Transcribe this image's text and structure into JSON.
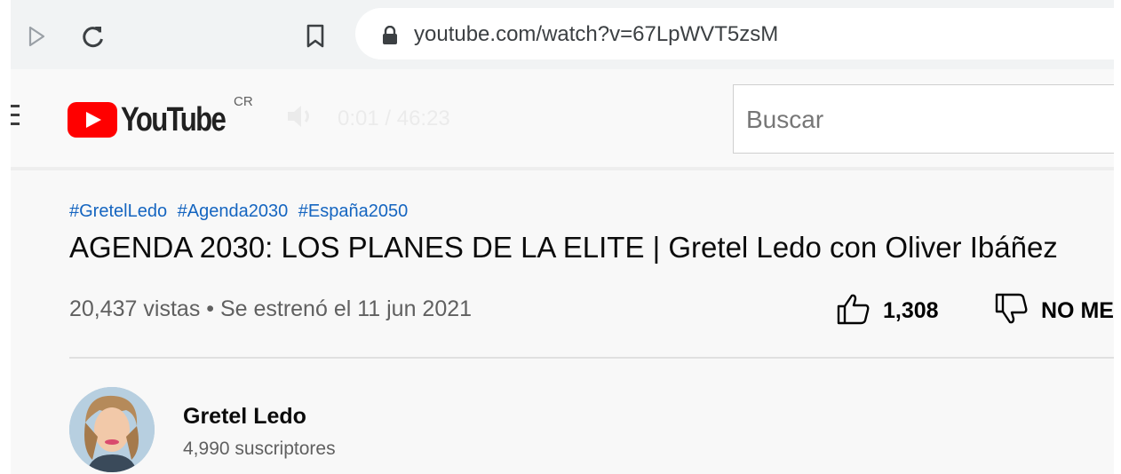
{
  "browser": {
    "url": "youtube.com/watch?v=67LpWVT5zsM"
  },
  "header": {
    "logo_text": "YouTube",
    "country_code": "CR",
    "player_time": "0:01 / 46:23",
    "search": {
      "placeholder": "Buscar"
    }
  },
  "video": {
    "hashtags": [
      "#GretelLedo",
      "#Agenda2030",
      "#España2050"
    ],
    "title": "AGENDA 2030: LOS PLANES DE LA ELITE | Gretel Ledo con Oliver Ibáñez",
    "meta": "20,437 vistas • Se estrenó el 11 jun 2021",
    "likes": "1,308",
    "dislike_label": "NO ME GUSTA"
  },
  "channel": {
    "name": "Gretel Ledo",
    "subscribers": "4,990 suscriptores"
  },
  "colors": {
    "brand_red": "#ff0000",
    "hashtag_blue": "#1565c0",
    "secondary_text": "#606060"
  },
  "icons": [
    "forward-icon",
    "reload-icon",
    "bookmark-icon",
    "lock-icon",
    "menu-icon",
    "volume-icon",
    "like-icon",
    "dislike-icon"
  ]
}
